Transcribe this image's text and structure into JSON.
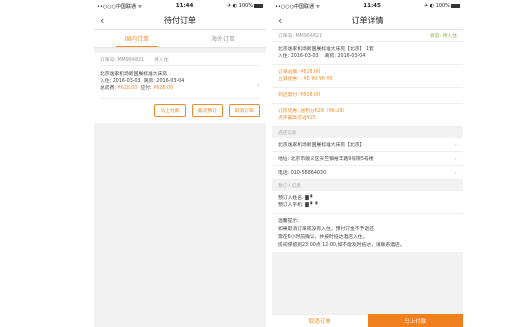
{
  "left": {
    "status": {
      "carrier": "••○○○中国联通 ᯤ",
      "time": "11:44",
      "battery": "✈ ◐ 100%"
    },
    "title": "待付订单",
    "tabs": [
      "国内订单",
      "海外订单"
    ],
    "order": {
      "order_no": "订单号: MM964821",
      "status": "待入住",
      "hotel": "北京逸家机场新国展标准大床房",
      "checkin": "入住: 2016-03-03",
      "checkout": "离房: 2016-03-04",
      "total_label": "总房费:",
      "total": "¥628.00",
      "pay_label": "应付:",
      "pay": "¥628.00"
    },
    "buttons": [
      "马上付款",
      "再次预订",
      "取消订单"
    ]
  },
  "right": {
    "status": {
      "carrier": "••○○○中国联通 ᯤ",
      "time": "11:45",
      "battery": "✈ ◐ 100%"
    },
    "title": "订单详情",
    "order_no": "订单号: MM964821",
    "state": "状态: 待入住",
    "hotel_line": "北京逸家机场新国展标准大床房【北京】  1套",
    "checkin": "入住: 2016-03-03",
    "checkout": "离房: 2016-03-04",
    "amount": "订单总额: ¥628.00",
    "discount": "立减优惠: - ¥0 ¥0 ¥0 ¥0",
    "prepay": "到店需付: ¥508.00",
    "coupon": "订房优惠: 送积分628（¥6.28）",
    "coupon_link": "点评最高可返¥25",
    "hotel_section": "酒店信息",
    "hotel_name": "北京逸家机场新国展标准大床房【北京】",
    "address": "地址: 北京市顺义区天竺镇裕丰路9号院5号楼",
    "phone": "电话: 010-56864030",
    "guest_section": "预订人信息",
    "guest_name": "预订人姓名: ▇ ▘",
    "guest_phone": "预订人手机: ▇ ▘ ▘",
    "notes_title": "温馨提示:",
    "notes": [
      "如果取消订单或没有入住，预付订金不予退还",
      "需在6小时前确认，并按时抵达酒店入住。",
      "房间保留到23:00点 12:00,如不能及时抵达，请联系酒店。"
    ],
    "cancel": "取消订单",
    "pay": "马上付款"
  }
}
